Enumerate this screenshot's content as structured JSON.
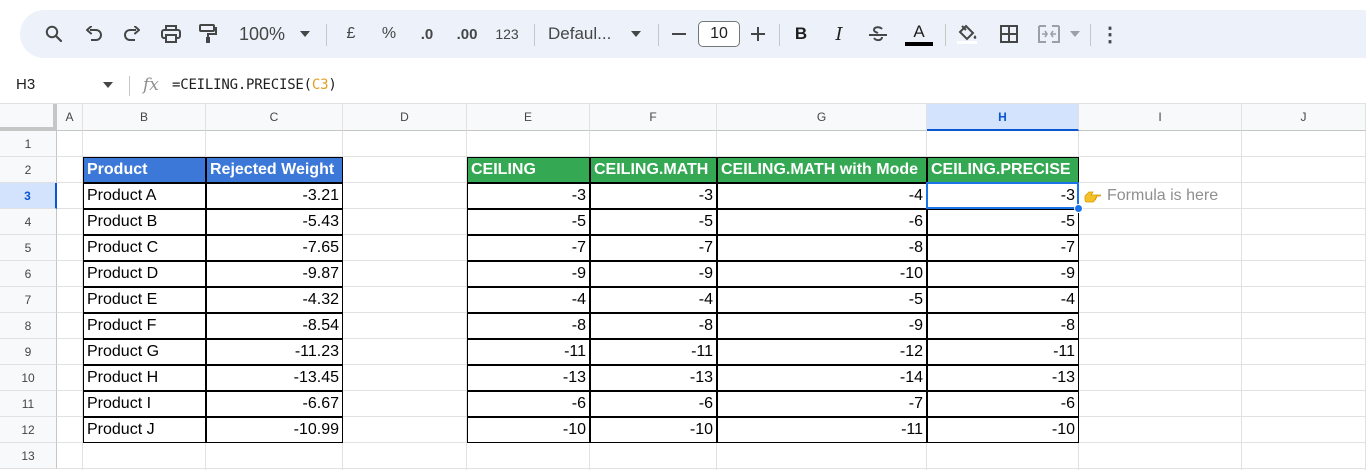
{
  "toolbar": {
    "zoom": "100%",
    "currency": "£",
    "percent": "%",
    "decrease_decimal": ".0",
    "increase_decimal": ".00",
    "number_format": "123",
    "font": "Defaul...",
    "font_size": "10",
    "minus": "—",
    "plus": "+",
    "bold": "B",
    "italic": "I",
    "text_color": "A",
    "more": "⋮",
    "icons": [
      "search-icon",
      "undo-icon",
      "redo-icon",
      "print-icon",
      "paint-format-icon",
      "bold-icon",
      "italic-icon",
      "strikethrough-icon",
      "text-color-icon",
      "fill-color-icon",
      "borders-icon",
      "merge-cells-icon",
      "more-icon"
    ]
  },
  "formula_bar": {
    "cell_ref": "H3",
    "fx": "fx",
    "formula_prefix": "=CEILING.PRECISE(",
    "formula_ref": "C3",
    "formula_suffix": ")"
  },
  "columns": [
    "A",
    "B",
    "C",
    "D",
    "E",
    "F",
    "G",
    "H",
    "I",
    "J"
  ],
  "rows": [
    "1",
    "2",
    "3",
    "4",
    "5",
    "6",
    "7",
    "8",
    "9",
    "10",
    "11",
    "12",
    "13"
  ],
  "selected": {
    "column": "H",
    "row": "3"
  },
  "colors": {
    "blue_header": "#3c78d8",
    "green_header": "#34a853",
    "selection": "#1a73e8",
    "formula_ref": "#e39f23"
  },
  "table1": {
    "headers": [
      "Product",
      "Rejected Weight"
    ],
    "rows": [
      [
        "Product A",
        "-3.21"
      ],
      [
        "Product B",
        "-5.43"
      ],
      [
        "Product C",
        "-7.65"
      ],
      [
        "Product D",
        "-9.87"
      ],
      [
        "Product E",
        "-4.32"
      ],
      [
        "Product F",
        "-8.54"
      ],
      [
        "Product G",
        "-11.23"
      ],
      [
        "Product H",
        "-13.45"
      ],
      [
        "Product I",
        "-6.67"
      ],
      [
        "Product J",
        "-10.99"
      ]
    ]
  },
  "table2": {
    "headers": [
      "CEILING",
      "CEILING.MATH",
      "CEILING.MATH with Mode",
      "CEILING.PRECISE"
    ],
    "rows": [
      [
        "-3",
        "-3",
        "-4",
        "-3"
      ],
      [
        "-5",
        "-5",
        "-6",
        "-5"
      ],
      [
        "-7",
        "-7",
        "-8",
        "-7"
      ],
      [
        "-9",
        "-9",
        "-10",
        "-9"
      ],
      [
        "-4",
        "-4",
        "-5",
        "-4"
      ],
      [
        "-8",
        "-8",
        "-9",
        "-8"
      ],
      [
        "-11",
        "-11",
        "-12",
        "-11"
      ],
      [
        "-13",
        "-13",
        "-14",
        "-13"
      ],
      [
        "-6",
        "-6",
        "-7",
        "-6"
      ],
      [
        "-10",
        "-10",
        "-11",
        "-10"
      ]
    ]
  },
  "annotation": {
    "text": "Formula is here"
  }
}
